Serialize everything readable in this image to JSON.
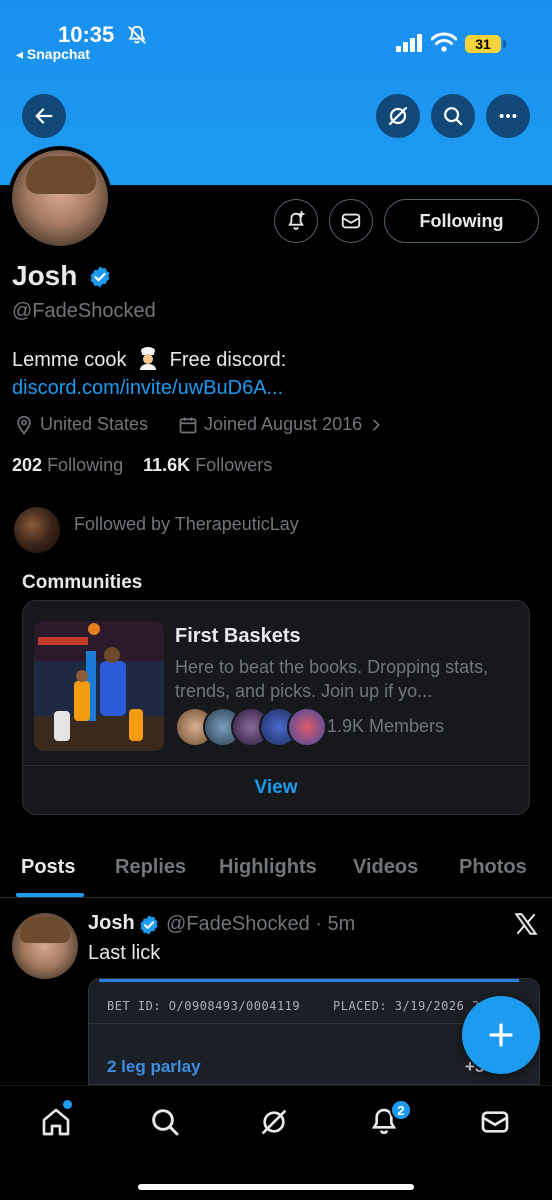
{
  "status_bar": {
    "time": "10:35",
    "back_app": "◂ Snapchat",
    "battery": "31"
  },
  "profile": {
    "name": "Josh",
    "handle": "@FadeShocked",
    "bio_text": "Lemme cook",
    "bio_middle": "Free discord:",
    "bio_link": "discord.com/invite/uwBuD6A...",
    "location": "United States",
    "joined": "Joined August 2016",
    "following_count": "202",
    "following_label": "Following",
    "followers_count": "11.6K",
    "followers_label": "Followers",
    "followed_by": "Followed by TherapeuticLay",
    "following_button": "Following"
  },
  "communities": {
    "title": "Communities",
    "card": {
      "name": "First Baskets",
      "description": "Here to beat the books. Dropping stats, trends, and picks. Join up if yo...",
      "members": "1.9K Members",
      "view_label": "View"
    }
  },
  "tabs": [
    {
      "label": "Posts",
      "active": true
    },
    {
      "label": "Replies",
      "active": false
    },
    {
      "label": "Highlights",
      "active": false
    },
    {
      "label": "Videos",
      "active": false
    },
    {
      "label": "Photos",
      "active": false
    }
  ],
  "post": {
    "name": "Josh",
    "handle_time": "@FadeShocked · 5m",
    "text": "Last lick",
    "bet_id": "BET ID: O/0908493/0004119",
    "bet_placed": "PLACED: 3/19/2026 2:4",
    "parlay": "2 leg parlay",
    "odds": "+3"
  },
  "nav": {
    "notification_count": "2"
  },
  "colors": {
    "accent": "#1d9bf0",
    "banner": "#1d9bf0",
    "background": "#000000",
    "muted": "#71767b"
  }
}
